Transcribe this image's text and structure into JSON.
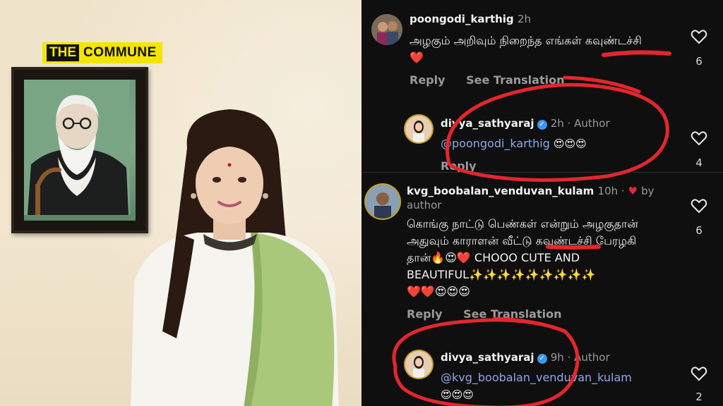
{
  "logo": {
    "the": "THE",
    "commune": "COMMUNE"
  },
  "colors": {
    "logo_bg": "#f4e500",
    "annotation_red": "#e3262d",
    "mention_blue": "#8fa8e6",
    "panel_bg": "#0f0f10"
  },
  "comments": [
    {
      "username": "poongodi_karthig",
      "time": "2h",
      "text_line1": "அழகும் அறிவும் நிறைந்த எங்கள் கவுண்டச்சி",
      "text_line2": "❤️",
      "reply_label": "Reply",
      "translation_label": "See Translation",
      "likes": "6",
      "reply": {
        "username": "divya_sathyaraj",
        "meta": "2h · Author",
        "mention": "@poongodi_karthig",
        "emojis": "😍😍😍",
        "reply_label": "Reply",
        "likes": "4"
      }
    },
    {
      "username": "kvg_boobalan_venduvan_kulam",
      "time": "10h",
      "by_label": "by",
      "author_label": "author",
      "text_line1": "கொங்கு நாட்டு பெண்கள் என்றும் அழகுதான்",
      "text_line2": "அதுவும் காராளன் வீட்டு கவுண்டச்சி பேரழகி",
      "text_line3_tamil": "தான்",
      "text_line3_rest": "🔥😍❤️ CHOOO CUTE AND",
      "text_line4": "BEAUTIFUL✨✨✨✨✨✨✨✨✨",
      "text_line5": "❤️❤️😍😍😍",
      "reply_label": "Reply",
      "translation_label": "See Translation",
      "likes": "6",
      "reply": {
        "username": "divya_sathyaraj",
        "meta": "9h · Author",
        "mention": "@kvg_boobalan_venduvan_kulam",
        "emojis": "😍😍😍",
        "likes": "2"
      }
    }
  ]
}
